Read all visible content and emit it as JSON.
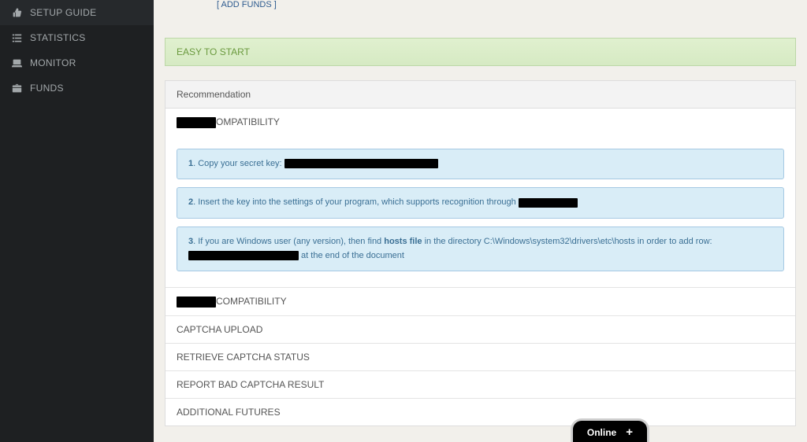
{
  "sidebar": {
    "items": [
      {
        "icon": "thumbs-up",
        "label": "SETUP GUIDE"
      },
      {
        "icon": "list",
        "label": "STATISTICS"
      },
      {
        "icon": "laptop",
        "label": "MONITOR"
      },
      {
        "icon": "briefcase",
        "label": "FUNDS"
      }
    ]
  },
  "topbar": {
    "add_funds_link": "[ ADD FUNDS ]"
  },
  "banner": {
    "text": "EASY TO START"
  },
  "panel": {
    "header": "Recommendation",
    "sections": [
      {
        "title_suffix": "OMPATIBILITY",
        "expanded": true,
        "tips": [
          {
            "num": "1",
            "text": ". Copy your secret key: "
          },
          {
            "num": "2",
            "text": ". Insert the key into the settings of your program, which supports recognition through "
          },
          {
            "num": "3",
            "pre": ". If you are Windows user (any version), then find ",
            "bold": "hosts file",
            "mid": "  in the directory  C:\\Windows\\system32\\drivers\\etc\\hosts  in order to add row: ",
            "post": " at the end of the document"
          }
        ]
      },
      {
        "title_suffix": "COMPATIBILITY",
        "expanded": false
      },
      {
        "title": "CAPTCHA UPLOAD",
        "expanded": false
      },
      {
        "title": "RETRIEVE CAPTCHA STATUS",
        "expanded": false
      },
      {
        "title": "REPORT BAD CAPTCHA RESULT",
        "expanded": false
      },
      {
        "title": "ADDITIONAL FUTURES",
        "expanded": false
      }
    ]
  },
  "chat": {
    "label": "Online"
  }
}
